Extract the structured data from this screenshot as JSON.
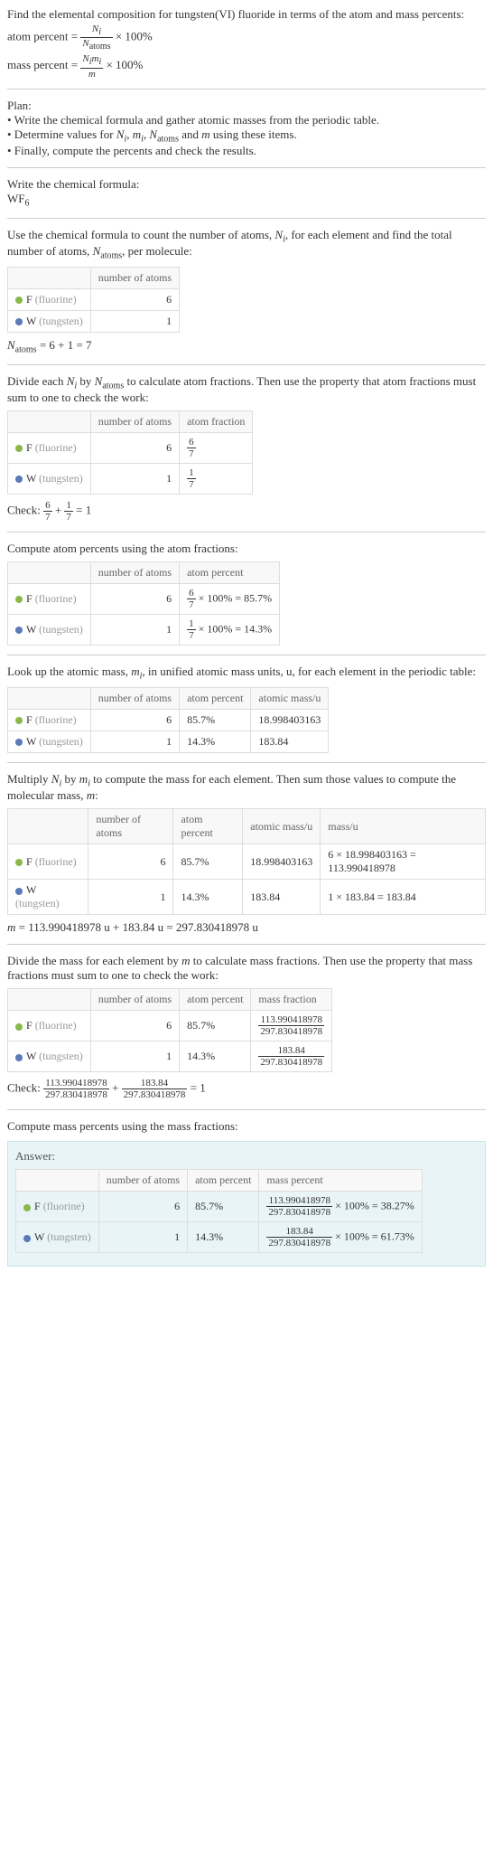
{
  "intro": {
    "line1": "Find the elemental composition for tungsten(VI) fluoride in terms of the atom and mass percents:",
    "atom_percent_label": "atom percent",
    "mass_percent_label": "mass percent",
    "eq": "=",
    "times100": "× 100%",
    "Ni": "N",
    "i": "i",
    "Natoms": "N",
    "atoms": "atoms",
    "mi": "m",
    "m": "m"
  },
  "plan": {
    "header": "Plan:",
    "b1": "• Write the chemical formula and gather atomic masses from the periodic table.",
    "b2_a": "• Determine values for ",
    "b2_b": " using these items.",
    "b3": "• Finally, compute the percents and check the results.",
    "vars": "N_i, m_i, N_atoms and m"
  },
  "formula": {
    "header": "Write the chemical formula:",
    "wf": "WF",
    "six": "6"
  },
  "count": {
    "text_a": "Use the chemical formula to count the number of atoms, ",
    "text_b": ", for each element and find the total number of atoms, ",
    "text_c": ", per molecule:",
    "col1": "number of atoms",
    "f_label": "F ",
    "f_paren": "(fluorine)",
    "w_label": "W ",
    "w_paren": "(tungsten)",
    "f_n": "6",
    "w_n": "1",
    "sum": " = 6 + 1 = 7"
  },
  "atomfrac": {
    "text": " to calculate atom fractions. Then use the property that atom fractions must sum to one to check the work:",
    "divide": "Divide each ",
    "by": " by ",
    "col2": "atom fraction",
    "f_num": "6",
    "f_den": "7",
    "w_num": "1",
    "w_den": "7",
    "check": "Check: ",
    "eqone": " = 1",
    "plus": " + "
  },
  "atompct": {
    "header": "Compute atom percents using the atom fractions:",
    "col2": "atom percent",
    "f_expr": " × 100% = 85.7%",
    "w_expr": " × 100% = 14.3%"
  },
  "atomic_mass": {
    "text_a": "Look up the atomic mass, ",
    "text_b": ", in unified atomic mass units, u, for each element in the periodic table:",
    "col3": "atomic mass/u",
    "f_pct": "85.7%",
    "w_pct": "14.3%",
    "f_mass": "18.998403163",
    "w_mass": "183.84"
  },
  "multiply": {
    "text_a": "Multiply ",
    "text_b": " to compute the mass for each element. Then sum those values to compute the molecular mass, ",
    "text_c": ":",
    "col4": "mass/u",
    "f_calc": "6 × 18.998403163 = 113.990418978",
    "w_calc": "1 × 183.84 = 183.84",
    "sum": " = 113.990418978 u + 183.84 u = 297.830418978 u"
  },
  "massfrac": {
    "text": " to calculate mass fractions. Then use the property that mass fractions must sum to one to check the work:",
    "divide": "Divide the mass for each element by ",
    "col3": "mass fraction",
    "f_num": "113.990418978",
    "den": "297.830418978",
    "w_num": "183.84",
    "check": "Check: ",
    "eqone": " = 1",
    "plus": " + "
  },
  "masspct": {
    "header": "Compute mass percents using the mass fractions:"
  },
  "answer": {
    "label": "Answer:",
    "col3": "mass percent",
    "f_expr_top": "113.990418978",
    "f_expr_bot": "297.830418978",
    "f_expr_res": "× 100% = 38.27%",
    "w_expr_top": "183.84",
    "w_expr_bot": "297.830418978",
    "w_expr_res": "× 100% = 61.73%"
  },
  "chart_data": {
    "type": "table",
    "tables": [
      {
        "title": "number of atoms",
        "rows": [
          {
            "element": "F (fluorine)",
            "atoms": 6
          },
          {
            "element": "W (tungsten)",
            "atoms": 1
          }
        ]
      },
      {
        "title": "atom fractions",
        "rows": [
          {
            "element": "F (fluorine)",
            "atoms": 6,
            "fraction": "6/7"
          },
          {
            "element": "W (tungsten)",
            "atoms": 1,
            "fraction": "1/7"
          }
        ]
      },
      {
        "title": "atom percents",
        "rows": [
          {
            "element": "F (fluorine)",
            "atoms": 6,
            "atom_percent": 85.7
          },
          {
            "element": "W (tungsten)",
            "atoms": 1,
            "atom_percent": 14.3
          }
        ]
      },
      {
        "title": "atomic mass",
        "rows": [
          {
            "element": "F (fluorine)",
            "atoms": 6,
            "atom_percent": 85.7,
            "atomic_mass_u": 18.998403163
          },
          {
            "element": "W (tungsten)",
            "atoms": 1,
            "atom_percent": 14.3,
            "atomic_mass_u": 183.84
          }
        ]
      },
      {
        "title": "element mass",
        "rows": [
          {
            "element": "F (fluorine)",
            "atoms": 6,
            "atom_percent": 85.7,
            "atomic_mass_u": 18.998403163,
            "mass_u": 113.990418978
          },
          {
            "element": "W (tungsten)",
            "atoms": 1,
            "atom_percent": 14.3,
            "atomic_mass_u": 183.84,
            "mass_u": 183.84
          }
        ],
        "molecular_mass_u": 297.830418978
      },
      {
        "title": "mass fractions",
        "rows": [
          {
            "element": "F (fluorine)",
            "atoms": 6,
            "atom_percent": 85.7,
            "mass_fraction": "113.990418978/297.830418978"
          },
          {
            "element": "W (tungsten)",
            "atoms": 1,
            "atom_percent": 14.3,
            "mass_fraction": "183.84/297.830418978"
          }
        ]
      },
      {
        "title": "answer",
        "rows": [
          {
            "element": "F (fluorine)",
            "atoms": 6,
            "atom_percent": 85.7,
            "mass_percent": 38.27
          },
          {
            "element": "W (tungsten)",
            "atoms": 1,
            "atom_percent": 14.3,
            "mass_percent": 61.73
          }
        ]
      }
    ]
  }
}
